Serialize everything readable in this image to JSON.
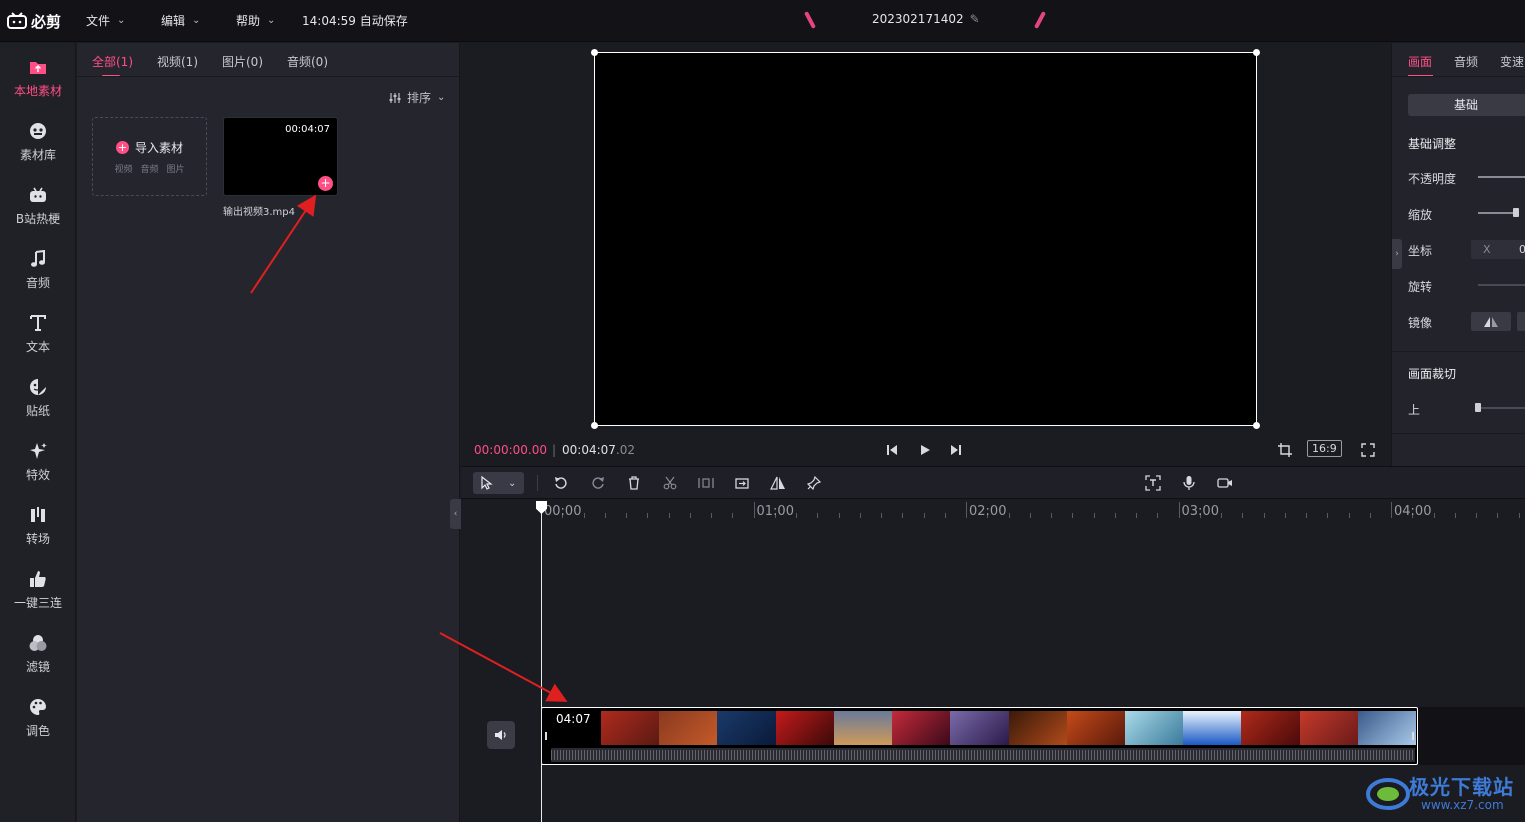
{
  "app": {
    "logo_text": "必剪",
    "menus": [
      "文件",
      "编辑",
      "帮助"
    ],
    "autosave": "14:04:59 自动保存",
    "project_name": "202302171402"
  },
  "colors": {
    "accent": "#ff4f85",
    "bg": "#1b1b22",
    "panel": "#25252e"
  },
  "sidebar": {
    "items": [
      {
        "label": "本地素材",
        "icon": "upload-folder-icon",
        "active": true
      },
      {
        "label": "素材库",
        "icon": "material-library-icon"
      },
      {
        "label": "B站热梗",
        "icon": "bilibili-tv-icon"
      },
      {
        "label": "音频",
        "icon": "music-note-icon"
      },
      {
        "label": "文本",
        "icon": "text-t-icon"
      },
      {
        "label": "贴纸",
        "icon": "sticker-icon"
      },
      {
        "label": "特效",
        "icon": "sparkle-effect-icon"
      },
      {
        "label": "转场",
        "icon": "transition-icon"
      },
      {
        "label": "一键三连",
        "icon": "thumbs-up-icon"
      },
      {
        "label": "滤镜",
        "icon": "filter-circles-icon"
      },
      {
        "label": "调色",
        "icon": "palette-icon"
      }
    ]
  },
  "media": {
    "tabs": [
      "全部(1)",
      "视频(1)",
      "图片(0)",
      "音频(0)"
    ],
    "active_tab": 0,
    "sort_label": "排序",
    "import": {
      "label": "导入素材",
      "types": [
        "视频",
        "音频",
        "图片"
      ]
    },
    "items": [
      {
        "duration": "00:04:07",
        "name": "输出视频3.mp4"
      }
    ]
  },
  "preview": {
    "current_time": "00:00:00.00",
    "total_time": "00:04:07",
    "total_frac": ".02",
    "aspect_ratio": "16:9"
  },
  "inspector": {
    "tabs": [
      "画面",
      "音频",
      "变速"
    ],
    "active_tab": 0,
    "basic_button": "基础",
    "section_basic": "基础调整",
    "opacity": "不透明度",
    "scale": "缩放",
    "position": "坐标",
    "position_x_label": "X",
    "position_x_value": "0",
    "rotation": "旋转",
    "mirror": "镜像",
    "section_crop": "画面裁切",
    "crop_top": "上"
  },
  "timeline": {
    "ruler_labels": [
      "00:00",
      "01:00",
      "02:00",
      "03:00",
      "04:00"
    ],
    "clip_duration": "04:07"
  },
  "watermark": {
    "text": "极光下载站",
    "url": "www.xz7.com"
  }
}
